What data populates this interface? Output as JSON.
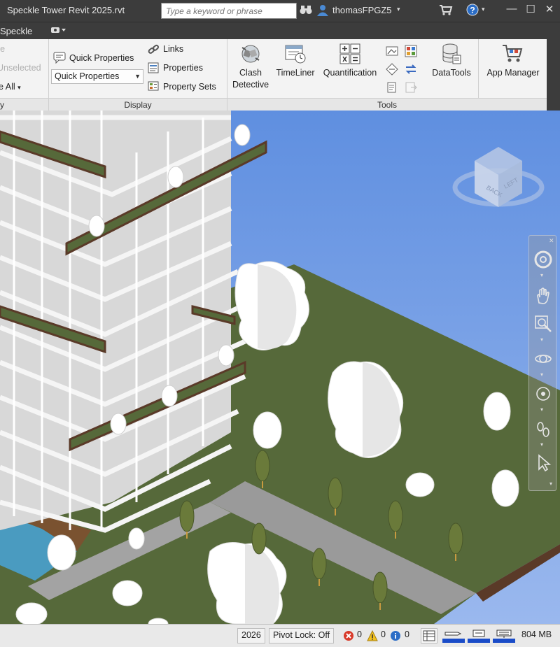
{
  "window": {
    "title": "Speckle Tower Revit 2025.rvt",
    "user": "thomasFPGZ5"
  },
  "search": {
    "placeholder": "Type a keyword or phrase"
  },
  "tabs": {
    "speckle": "Speckle"
  },
  "ribbon": {
    "left_panel": {
      "item1": "re",
      "item2": "Unselected",
      "item3": "e All",
      "footer": "y"
    },
    "display": {
      "quick_properties": "Quick Properties",
      "combo_value": "Quick Properties",
      "links": "Links",
      "properties": "Properties",
      "property_sets": "Property Sets",
      "footer": "Display"
    },
    "tools": {
      "clash_line1": "Clash",
      "clash_line2": "Detective",
      "timeliner": "TimeLiner",
      "quantification": "Quantification",
      "datatools": "DataTools",
      "app_manager": "App Manager",
      "footer": "Tools"
    }
  },
  "viewcube": {
    "face_back": "BACK",
    "face_left": "LEFT"
  },
  "statusbar": {
    "year": "2026",
    "pivot_lock": "Pivot Lock: Off",
    "errors": "0",
    "warnings": "0",
    "info": "0",
    "memory": "804 MB"
  },
  "colors": {
    "sky": "#6f99e0",
    "grass": "#56693a",
    "road": "#9a9a9a",
    "water": "#4a9bc0",
    "ribbon_bg": "#f3f3f3",
    "chrome_dark": "#3c3c3c"
  }
}
